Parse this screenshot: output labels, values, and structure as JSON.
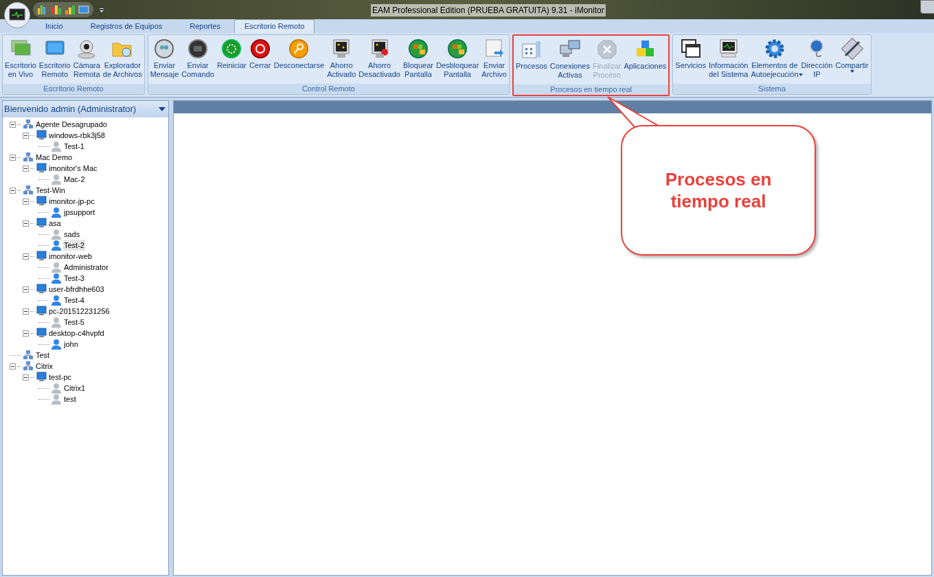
{
  "window": {
    "title": "EAM Professional Edition (PRUEBA GRATUITA) 9.31 - iMonitor"
  },
  "tabs": [
    {
      "label": "Inicio",
      "selected": false
    },
    {
      "label": "Registros de Equipos",
      "selected": false
    },
    {
      "label": "Reportes",
      "selected": false
    },
    {
      "label": "Escritorio Remoto",
      "selected": true
    }
  ],
  "ribbon_groups": [
    {
      "title": "Escritorio Remoto",
      "highlighted": false,
      "buttons": [
        {
          "label": [
            "Escritorio",
            "en Vivo"
          ],
          "disabled": false
        },
        {
          "label": [
            "Escritorio",
            "Remoto"
          ],
          "disabled": false
        },
        {
          "label": [
            "Cámara",
            "Remota"
          ],
          "disabled": false
        },
        {
          "label": [
            "Explorador",
            "de Archivos"
          ],
          "disabled": false
        }
      ]
    },
    {
      "title": "Control Remoto",
      "highlighted": false,
      "buttons": [
        {
          "label": [
            "Enviar",
            "Mensaje"
          ],
          "disabled": false
        },
        {
          "label": [
            "Enviar",
            "Comando"
          ],
          "disabled": false
        },
        {
          "label": [
            "Reiniciar"
          ],
          "disabled": false
        },
        {
          "label": [
            "Cerrar"
          ],
          "disabled": false
        },
        {
          "label": [
            "Desconectarse"
          ],
          "disabled": false
        },
        {
          "label": [
            "Ahorro",
            "Activado"
          ],
          "disabled": false
        },
        {
          "label": [
            "Ahorro",
            "Desactivado"
          ],
          "disabled": false
        },
        {
          "label": [
            "Bloquear",
            "Pantalla"
          ],
          "disabled": false
        },
        {
          "label": [
            "Desbloquear",
            "Pantalla"
          ],
          "disabled": false
        },
        {
          "label": [
            "Enviar",
            "Archivo"
          ],
          "disabled": false
        }
      ]
    },
    {
      "title": "Procesos en tiempo real",
      "highlighted": true,
      "buttons": [
        {
          "label": [
            "Procesos"
          ],
          "disabled": false
        },
        {
          "label": [
            "Conexiones",
            "Activas"
          ],
          "disabled": false
        },
        {
          "label": [
            "Finalizar",
            "Proceso"
          ],
          "disabled": true
        },
        {
          "label": [
            "Aplicaciones"
          ],
          "disabled": false
        }
      ]
    },
    {
      "title": "Sistema",
      "highlighted": false,
      "buttons": [
        {
          "label": [
            "Servicios"
          ],
          "disabled": false
        },
        {
          "label": [
            "Información",
            "del Sistema"
          ],
          "disabled": false
        },
        {
          "label": [
            "Elementos de",
            "Autoejecución"
          ],
          "disabled": false,
          "dropdown": true
        },
        {
          "label": [
            "Dirección",
            "IP"
          ],
          "disabled": false
        },
        {
          "label": [
            "Compartir"
          ],
          "disabled": false,
          "dropdown": true
        }
      ]
    }
  ],
  "sidebar": {
    "title": "Bienvenido admin (Administrator)",
    "tree": [
      {
        "label": "Agente Desagrupado",
        "kind": "group",
        "expanded": true,
        "children": [
          {
            "label": "windows-rbk3j58",
            "kind": "computer",
            "expanded": true,
            "children": [
              {
                "label": "Test-1",
                "kind": "user",
                "online": false,
                "selected": false
              }
            ]
          }
        ]
      },
      {
        "label": "Mac Demo",
        "kind": "group",
        "expanded": true,
        "children": [
          {
            "label": "imonitor's Mac",
            "kind": "computer",
            "expanded": true,
            "children": [
              {
                "label": "Mac-2",
                "kind": "user",
                "online": false,
                "selected": false
              }
            ]
          }
        ]
      },
      {
        "label": "Test-Win",
        "kind": "group",
        "expanded": true,
        "children": [
          {
            "label": "imonitor-jp-pc",
            "kind": "computer",
            "expanded": true,
            "children": [
              {
                "label": "jpsupport",
                "kind": "user",
                "online": true,
                "selected": false
              }
            ]
          },
          {
            "label": "asa",
            "kind": "computer",
            "expanded": true,
            "children": [
              {
                "label": "sads",
                "kind": "user",
                "online": false,
                "selected": false
              },
              {
                "label": "Test-2",
                "kind": "user",
                "online": true,
                "selected": true
              }
            ]
          },
          {
            "label": "imonitor-web",
            "kind": "computer",
            "expanded": true,
            "children": [
              {
                "label": "Administrator",
                "kind": "user",
                "online": false,
                "selected": false
              },
              {
                "label": "Test-3",
                "kind": "user",
                "online": true,
                "selected": false
              }
            ]
          },
          {
            "label": "user-bfrdhhe603",
            "kind": "computer",
            "expanded": true,
            "children": [
              {
                "label": "Test-4",
                "kind": "user",
                "online": true,
                "selected": false
              }
            ]
          },
          {
            "label": "pc-201512231256",
            "kind": "computer",
            "expanded": true,
            "children": [
              {
                "label": "Test-5",
                "kind": "user",
                "online": false,
                "selected": false
              }
            ]
          },
          {
            "label": "desktop-c4hvpfd",
            "kind": "computer",
            "expanded": true,
            "children": [
              {
                "label": "john",
                "kind": "user",
                "online": true,
                "selected": false
              }
            ]
          }
        ]
      },
      {
        "label": "Test",
        "kind": "group"
      },
      {
        "label": "Citrix",
        "kind": "group",
        "expanded": true,
        "children": [
          {
            "label": "test-pc",
            "kind": "computer",
            "expanded": true,
            "children": [
              {
                "label": "Citrix1",
                "kind": "user",
                "online": false,
                "selected": false
              },
              {
                "label": "test",
                "kind": "user",
                "online": false,
                "selected": false
              }
            ]
          }
        ]
      }
    ]
  },
  "callout": {
    "text": "Procesos en tiempo real"
  }
}
